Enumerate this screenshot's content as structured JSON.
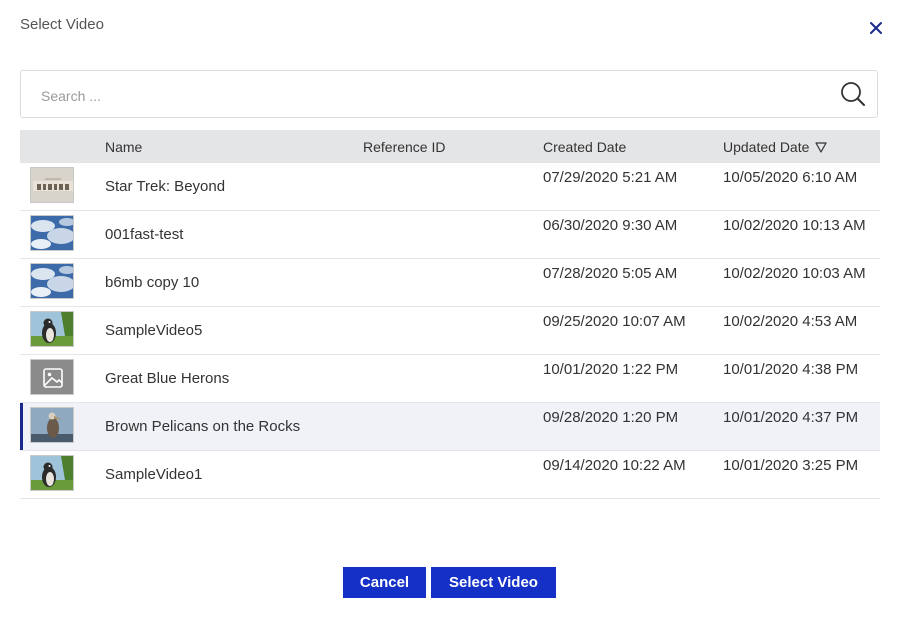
{
  "dialog": {
    "title": "Select Video",
    "close_icon": "close-icon"
  },
  "search": {
    "placeholder": "Search ...",
    "value": "",
    "icon": "search-icon"
  },
  "table": {
    "columns": {
      "name": "Name",
      "reference_id": "Reference ID",
      "created": "Created Date",
      "updated": "Updated Date",
      "sort_icon": "sort-descending-icon"
    },
    "rows": [
      {
        "thumb": "star-trek-beyond-thumbnail",
        "name": "Star Trek: Beyond",
        "reference_id": "",
        "created": "07/29/2020 5:21 AM",
        "updated": "10/05/2020 6:10 AM",
        "selected": false
      },
      {
        "thumb": "clouds-thumbnail",
        "name": "001fast-test",
        "reference_id": "",
        "created": "06/30/2020 9:30 AM",
        "updated": "10/02/2020 10:13 AM",
        "selected": false
      },
      {
        "thumb": "clouds-thumbnail",
        "name": "b6mb copy 10",
        "reference_id": "",
        "created": "07/28/2020 5:05 AM",
        "updated": "10/02/2020 10:03 AM",
        "selected": false
      },
      {
        "thumb": "penguin-thumbnail",
        "name": "SampleVideo5",
        "reference_id": "",
        "created": "09/25/2020 10:07 AM",
        "updated": "10/02/2020 4:53 AM",
        "selected": false
      },
      {
        "thumb": "image-placeholder-icon",
        "name": "Great Blue Herons",
        "reference_id": "",
        "created": "10/01/2020 1:22 PM",
        "updated": "10/01/2020 4:38 PM",
        "selected": false
      },
      {
        "thumb": "pelican-thumbnail",
        "name": "Brown Pelicans on the Rocks",
        "reference_id": "",
        "created": "09/28/2020 1:20 PM",
        "updated": "10/01/2020 4:37 PM",
        "selected": true
      },
      {
        "thumb": "penguin-thumbnail",
        "name": "SampleVideo1",
        "reference_id": "",
        "created": "09/14/2020 10:22 AM",
        "updated": "10/01/2020 3:25 PM",
        "selected": false
      }
    ]
  },
  "buttons": {
    "cancel": "Cancel",
    "select": "Select Video"
  },
  "colors": {
    "primary_button": "#1530c7",
    "header_bg": "#e4e5e7",
    "selected_accent": "#1a2a8a"
  }
}
